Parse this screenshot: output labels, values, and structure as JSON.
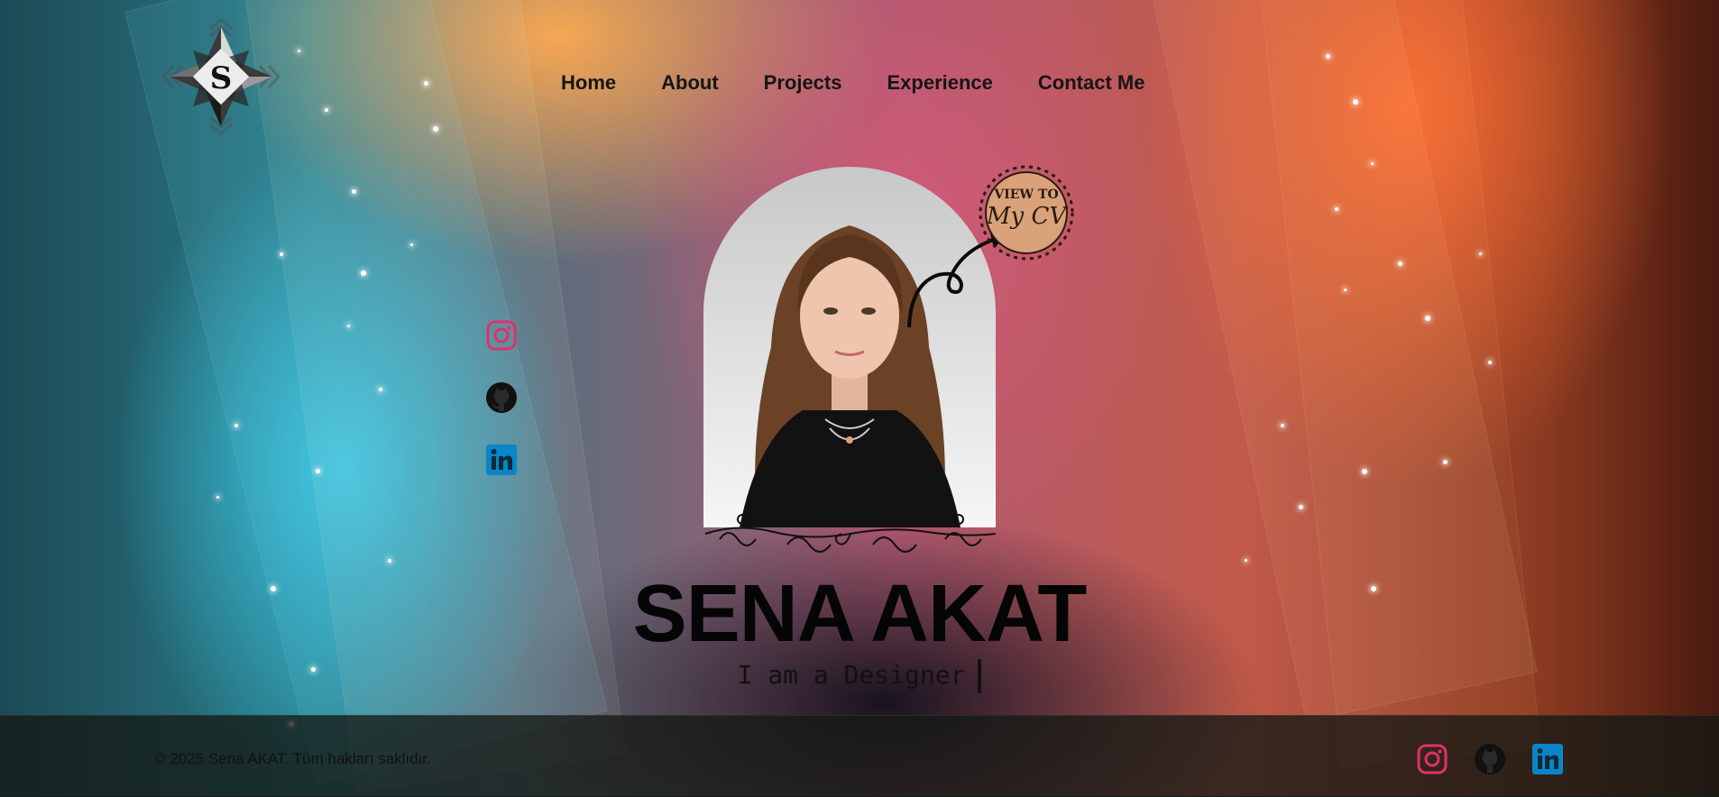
{
  "nav": {
    "items": [
      "Home",
      "About",
      "Projects",
      "Experience",
      "Contact Me"
    ]
  },
  "hero": {
    "name": "SENA AKAT",
    "tagline": "I am a Designer",
    "cv_badge_line1": "VIEW TO",
    "cv_badge_line2": "My CV"
  },
  "logo": {
    "letter": "S"
  },
  "socials": {
    "icons": [
      "instagram-icon",
      "github-icon",
      "linkedin-icon"
    ]
  },
  "footer": {
    "copyright": "© 2025 Sena AKAT. Tüm hakları saklıdır."
  },
  "colors": {
    "instagram": "#e1306c",
    "github": "#111111",
    "linkedin": "#0a85c9",
    "cv_badge": "#d9a27a"
  }
}
